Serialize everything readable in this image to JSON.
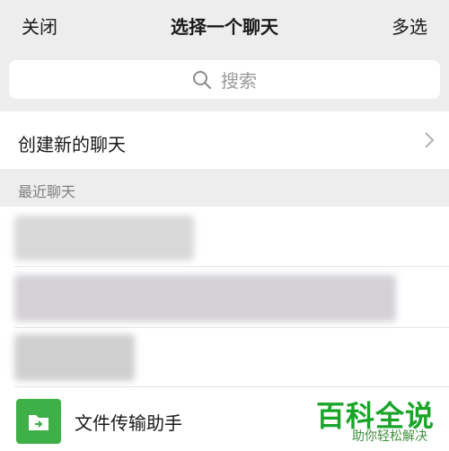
{
  "header": {
    "close_label": "关闭",
    "title": "选择一个聊天",
    "multiselect_label": "多选"
  },
  "search": {
    "placeholder": "搜索"
  },
  "create_chat": {
    "label": "创建新的聊天"
  },
  "recent_section": {
    "label": "最近聊天"
  },
  "chats": [
    {
      "name": "",
      "blurred": true
    },
    {
      "name": "",
      "blurred": true
    },
    {
      "name": "",
      "blurred": true
    },
    {
      "name": "文件传输助手",
      "icon": "file-transfer-icon",
      "icon_color": "#3eb047"
    }
  ],
  "watermark": {
    "title": "百科全说",
    "subtitle": "助你轻松解决",
    "color": "#1aa52a"
  }
}
